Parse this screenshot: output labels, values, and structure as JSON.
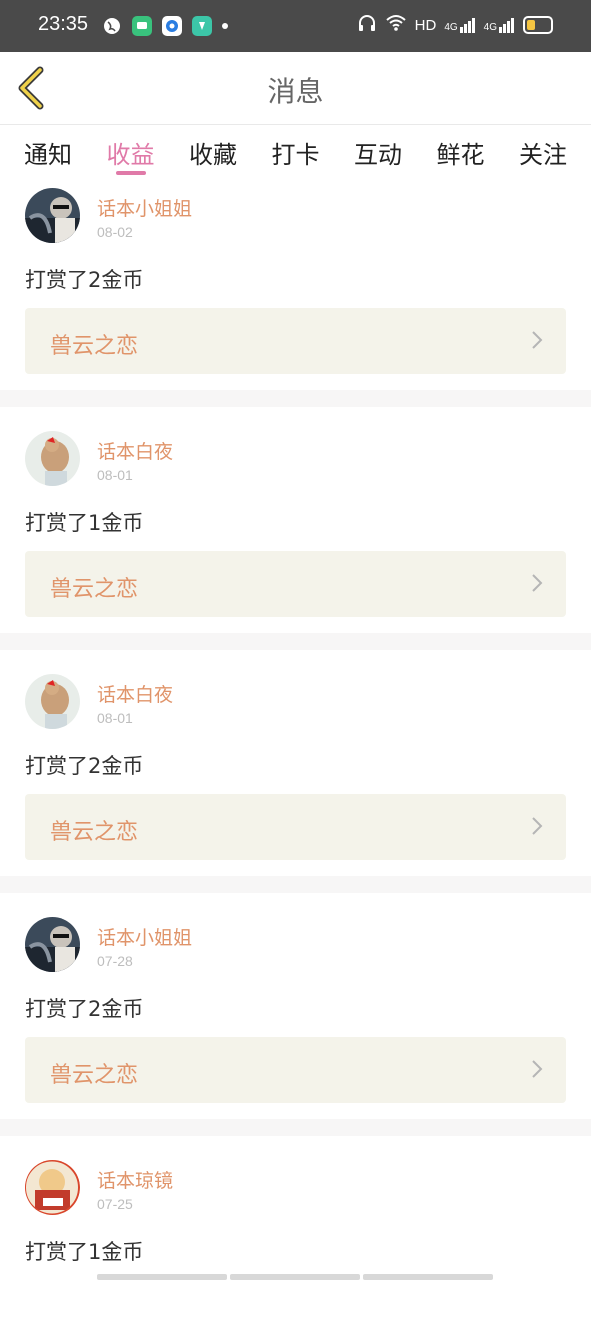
{
  "status_bar": {
    "time": "23:35",
    "network": "HD",
    "signal1": "4G",
    "signal2": "4G",
    "icons": [
      "globe-icon",
      "chat-app-icon",
      "browser-icon",
      "music-app-icon"
    ]
  },
  "header": {
    "title": "消息",
    "back_icon": "chevron-left-icon"
  },
  "tabs": [
    {
      "label": "通知",
      "active": false
    },
    {
      "label": "收益",
      "active": true
    },
    {
      "label": "收藏",
      "active": false
    },
    {
      "label": "打卡",
      "active": false
    },
    {
      "label": "互动",
      "active": false
    },
    {
      "label": "鲜花",
      "active": false
    },
    {
      "label": "关注",
      "active": false
    }
  ],
  "feed": [
    {
      "user": "话本小姐姐",
      "date": "08-02",
      "action": "打赏了2金币",
      "book": "兽云之恋",
      "avatar": "avatar-photo-driver"
    },
    {
      "user": "话本白夜",
      "date": "08-01",
      "action": "打赏了1金币",
      "book": "兽云之恋",
      "avatar": "avatar-photo-girl"
    },
    {
      "user": "话本白夜",
      "date": "08-01",
      "action": "打赏了2金币",
      "book": "兽云之恋",
      "avatar": "avatar-photo-girl"
    },
    {
      "user": "话本小姐姐",
      "date": "07-28",
      "action": "打赏了2金币",
      "book": "兽云之恋",
      "avatar": "avatar-photo-driver"
    },
    {
      "user": "话本琼镜",
      "date": "07-25",
      "action": "打赏了1金币",
      "book": "",
      "avatar": "avatar-photo-cartoon"
    }
  ],
  "colors": {
    "accent_pink": "#e07aa8",
    "name_orange": "#e0946a",
    "card_bg": "#f4f3ea"
  }
}
